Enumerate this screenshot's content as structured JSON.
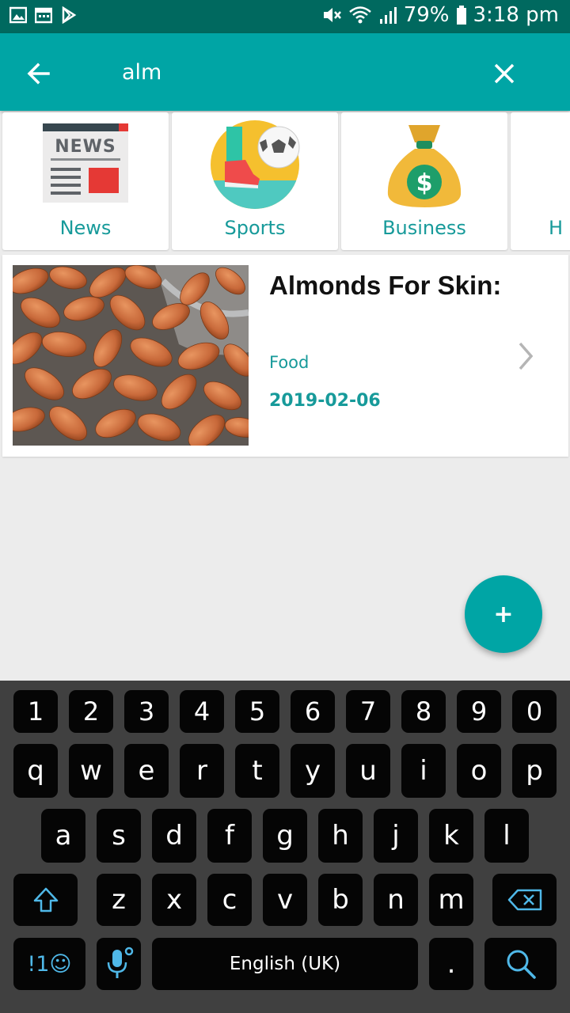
{
  "status_bar": {
    "battery": "79%",
    "time": "3:18 pm"
  },
  "search": {
    "query": "alm"
  },
  "categories": [
    {
      "label": "News",
      "icon": "news-icon"
    },
    {
      "label": "Sports",
      "icon": "sports-icon"
    },
    {
      "label": "Business",
      "icon": "business-icon"
    },
    {
      "label": "H",
      "icon": "health-icon"
    }
  ],
  "article": {
    "title": "Almonds For Skin:",
    "category": "Food",
    "date": "2019-02-06"
  },
  "fab": {
    "label": "+"
  },
  "keyboard": {
    "row1": [
      "1",
      "2",
      "3",
      "4",
      "5",
      "6",
      "7",
      "8",
      "9",
      "0"
    ],
    "row2": [
      "q",
      "w",
      "e",
      "r",
      "t",
      "y",
      "u",
      "i",
      "o",
      "p"
    ],
    "row3": [
      "a",
      "s",
      "d",
      "f",
      "g",
      "h",
      "j",
      "k",
      "l"
    ],
    "row4": [
      "z",
      "x",
      "c",
      "v",
      "b",
      "n",
      "m"
    ],
    "symbols_label": "!1☺",
    "space_label": "English (UK)",
    "period_label": "."
  },
  "colors": {
    "status_bar": "#00695f",
    "toolbar": "#00a5a5",
    "accent_text": "#179a9a",
    "keyboard_bg": "#404040",
    "key_bg": "#050505",
    "key_icon_blue": "#4fb8e8"
  }
}
